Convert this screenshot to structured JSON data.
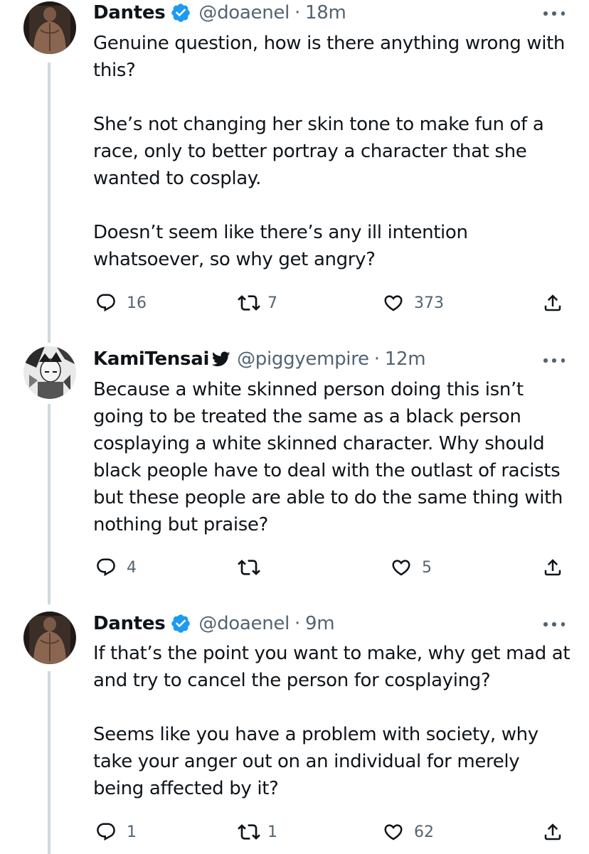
{
  "tweets": [
    {
      "name": "Dantes",
      "handle": "@doaenel",
      "separator": "·",
      "time": "18m",
      "verified": true,
      "text": "Genuine question, how is there anything wrong with this?\n\nShe’s not changing her skin tone to make fun of a race, only to better portray a character that she wanted to cosplay.\n\nDoesn’t seem like there’s any ill intention whatsoever, so why get angry?",
      "replies": "16",
      "retweets": "7",
      "likes": "373"
    },
    {
      "name": "KamiTensai",
      "handle": "@piggyempire",
      "separator": "·",
      "time": "12m",
      "verified": false,
      "text": "Because a white skinned person doing this isn’t going to be treated the same as a black person cosplaying a white skinned character. Why should black people have to deal with the outlast of racists but these people are able to do the same thing with nothing but praise?",
      "replies": "4",
      "retweets": "",
      "likes": "5"
    },
    {
      "name": "Dantes",
      "handle": "@doaenel",
      "separator": "·",
      "time": "9m",
      "verified": true,
      "text": "If that’s the point you want to make, why get mad at and try to cancel the person for cosplaying?\n\nSeems like you have a problem with society, why take your anger out on an individual for merely being affected by it?",
      "replies": "1",
      "retweets": "1",
      "likes": "62"
    }
  ],
  "icons": {
    "verified": "verified-badge-icon",
    "name_emoji": "bird-icon",
    "reply": "reply-icon",
    "retweet": "retweet-icon",
    "like": "heart-icon",
    "share": "share-icon",
    "more": "more-icon"
  },
  "colors": {
    "text": "#0f1419",
    "secondary": "#536471",
    "verified": "#1d9bf0",
    "thread_line": "#cfd9de"
  }
}
